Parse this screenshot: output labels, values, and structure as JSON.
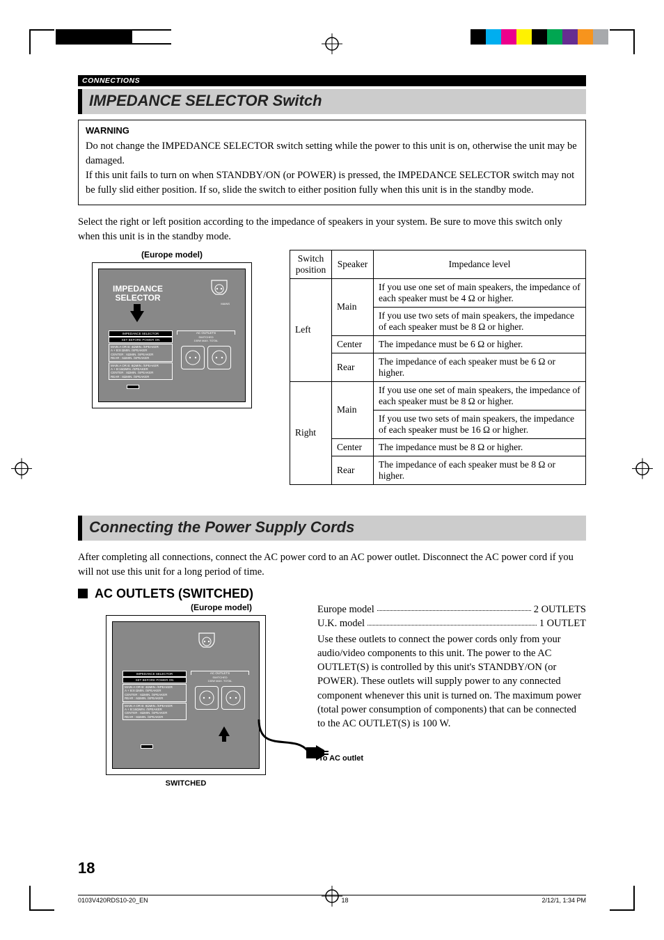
{
  "header_bar": "CONNECTIONS",
  "section1": {
    "title": "IMPEDANCE SELECTOR Switch",
    "warning_heading": "WARNING",
    "warning_p1": "Do not change the IMPEDANCE SELECTOR switch setting while the power to this unit is on, otherwise the unit may be damaged.",
    "warning_p2": "If this unit fails to turn on when STANDBY/ON (or POWER) is pressed, the IMPEDANCE SELECTOR switch may not be fully slid either position. If so, slide the switch to either position fully when this unit is in the standby mode.",
    "intro": "Select the right or left position according to the impedance of speakers in your system. Be sure to move this switch only when this unit is in the standby mode.",
    "figure_caption": "(Europe model)",
    "figure_label": "IMPEDANCE SELECTOR",
    "selector_header": "IMPEDANCE SELECTOR",
    "selector_caution": "SET BEFORE POWER ON",
    "selector_left": "MAIN A OR B: 4ΩMIN. /SPEAKER\nA + B:8 ΩMIN. /SPEAKER\nCENTER : 6ΩMIN. /SPEAKER\nREAR : 6ΩMIN. /SPEAKER",
    "selector_right": "MAIN A OR B: 8ΩMIN. /SPEAKER\nA + B:16ΩMIN. /SPEAKER\nCENTER : 8ΩMIN. /SPEAKER\nREAR : 8ΩMIN. /SPEAKER",
    "ac_outlets_label": "AC OUTLETS",
    "ac_switched_label": "SWITCHED\n100W MAX. TOTAL",
    "mains_label": "MAINS"
  },
  "table": {
    "h_switch": "Switch position",
    "h_speaker": "Speaker",
    "h_level": "Impedance level",
    "rows": [
      {
        "pos": "Left",
        "spk": "Main",
        "lvl": "If you use one set of main speakers, the impedance of each speaker must be 4 Ω or higher."
      },
      {
        "pos": "",
        "spk": "",
        "lvl": "If you use two sets of main speakers, the impedance of each speaker must be 8 Ω or higher."
      },
      {
        "pos": "",
        "spk": "Center",
        "lvl": "The impedance must be 6 Ω or higher."
      },
      {
        "pos": "",
        "spk": "Rear",
        "lvl": "The impedance of each speaker must be 6 Ω or higher."
      },
      {
        "pos": "Right",
        "spk": "Main",
        "lvl": "If you use one set of main speakers, the impedance of each speaker must be 8 Ω or higher."
      },
      {
        "pos": "",
        "spk": "",
        "lvl": "If you use two sets of main speakers, the impedance of each speaker must be 16 Ω or higher."
      },
      {
        "pos": "",
        "spk": "Center",
        "lvl": "The impedance must be 8 Ω or higher."
      },
      {
        "pos": "",
        "spk": "Rear",
        "lvl": "The impedance of each speaker must be 8 Ω or higher."
      }
    ]
  },
  "section2": {
    "title": "Connecting the Power Supply Cords",
    "intro": "After completing all connections, connect the AC power cord to an AC power outlet. Disconnect the AC power cord if you will not use this unit for a long period of time.",
    "sub_heading": "AC OUTLETS (SWITCHED)",
    "figure_caption": "(Europe model)",
    "to_ac_outlet": "To AC outlet",
    "switched": "SWITCHED",
    "line1_left": "Europe model",
    "line1_right": "2 OUTLETS",
    "line2_left": "U.K. model",
    "line2_right": "1 OUTLET",
    "body": "Use these outlets to connect the power cords only from your audio/video components to this unit. The power to the AC OUTLET(S) is controlled by this unit's STANDBY/ON (or POWER). These outlets will supply power to any connected component whenever this unit is turned on. The maximum power (total power consumption of components) that can be connected to the AC OUTLET(S) is 100 W."
  },
  "page_number": "18",
  "footer": {
    "left": "0103V420RDS10-20_EN",
    "center": "18",
    "right": "2/12/1, 1:34 PM"
  },
  "reg_colors_left": [
    "#000",
    "#000",
    "#000",
    "#000",
    "#000",
    "#fff",
    "#fff",
    "#fff",
    "#fff"
  ],
  "reg_colors_right": [
    "#000",
    "#00aeef",
    "#ec008c",
    "#fff200",
    "#000",
    "#00a651",
    "#662d91",
    "#f7941d",
    "#a7a9ac"
  ]
}
